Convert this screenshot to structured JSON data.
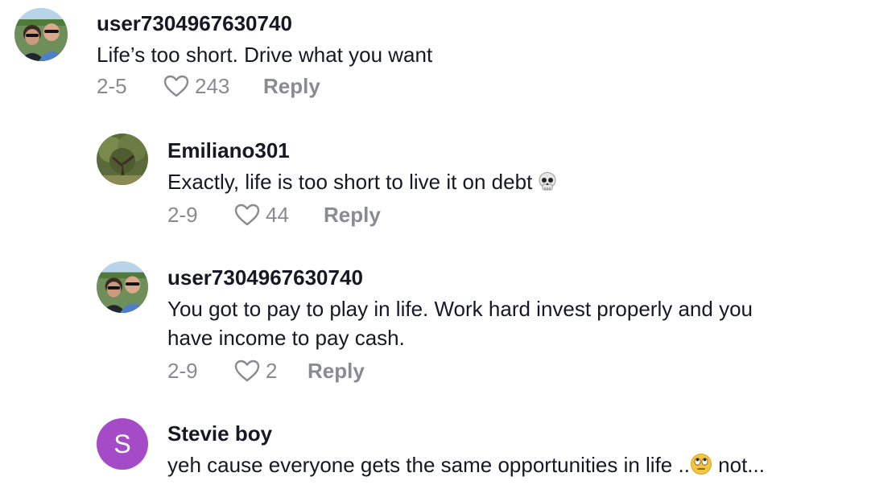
{
  "comments": [
    {
      "username": "user7304967630740",
      "text": "Life’s too short. Drive what you want",
      "date": "2-5",
      "likes": "243",
      "reply_label": "Reply",
      "avatar_icon": "couple-photo-avatar"
    },
    {
      "username": "Emiliano301",
      "text": "Exactly, life is too short to live it on debt",
      "date": "2-9",
      "likes": "44",
      "reply_label": "Reply",
      "avatar_icon": "tree-photo-avatar",
      "trailing_icon": "skull-emoji"
    },
    {
      "username": "user7304967630740",
      "text_line1": "You got to pay to play in life. Work hard invest properly and you",
      "text_line2": "have income to pay cash.",
      "date": "2-9",
      "likes": "2",
      "reply_label": "Reply",
      "avatar_icon": "couple-photo-avatar"
    },
    {
      "username": "Stevie boy",
      "avatar_letter": "S",
      "text_start": "yeh cause everyone gets the same opportunities in life ..",
      "text_end": " not...",
      "inline_icon": "rolling-eyes-emoji"
    }
  ],
  "colors": {
    "username": "#161823",
    "meta": "#8a8b91",
    "letter_avatar": "#a64bc7"
  }
}
